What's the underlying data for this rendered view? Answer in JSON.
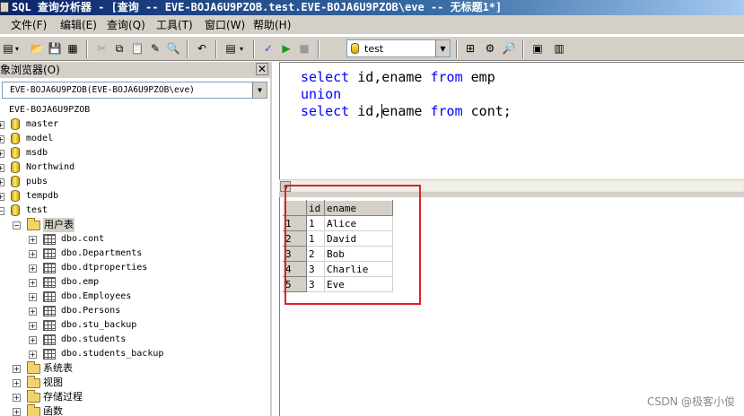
{
  "window": {
    "title": "SQL 查询分析器 - [查询 -- EVE-BOJA6U9PZOB.test.EVE-BOJA6U9PZOB\\eve -- 无标题1*]"
  },
  "menu": [
    "文件(F)",
    "编辑(E)",
    "查询(Q)",
    "工具(T)",
    "窗口(W)",
    "帮助(H)"
  ],
  "toolbar": {
    "database": "test"
  },
  "object_browser": {
    "title": "象浏览器(O)",
    "server_select": "EVE-BOJA6U9PZOB(EVE-BOJA6U9PZOB\\eve)",
    "server": "EVE-BOJA6U9PZOB",
    "databases": [
      "master",
      "model",
      "msdb",
      "Northwind",
      "pubs",
      "tempdb",
      "test"
    ],
    "user_tables_label": "用户表",
    "tables": [
      "dbo.cont",
      "dbo.Departments",
      "dbo.dtproperties",
      "dbo.emp",
      "dbo.Employees",
      "dbo.Persons",
      "dbo.stu_backup",
      "dbo.students",
      "dbo.students_backup"
    ],
    "folders": [
      "系统表",
      "视图",
      "存储过程",
      "函数"
    ]
  },
  "editor": {
    "line1": {
      "kw1": "select",
      "t1": " id,ename ",
      "kw2": "from",
      "t2": " emp"
    },
    "line2": {
      "kw1": "union"
    },
    "line3": {
      "kw1": "select",
      "t1a": " id,",
      "t1b": "ename ",
      "kw2": "from",
      "t2": " cont;"
    }
  },
  "results": {
    "columns": [
      "id",
      "ename"
    ],
    "rows": [
      {
        "n": "1",
        "id": "1",
        "ename": "Alice"
      },
      {
        "n": "2",
        "id": "1",
        "ename": "David"
      },
      {
        "n": "3",
        "id": "2",
        "ename": "Bob"
      },
      {
        "n": "4",
        "id": "3",
        "ename": "Charlie"
      },
      {
        "n": "5",
        "id": "3",
        "ename": "Eve"
      }
    ]
  },
  "watermark": "CSDN @极客小俊",
  "colors": {
    "keyword": "#0000ff",
    "highlight_box": "#e0202a",
    "title_bar": "#0a246a"
  }
}
